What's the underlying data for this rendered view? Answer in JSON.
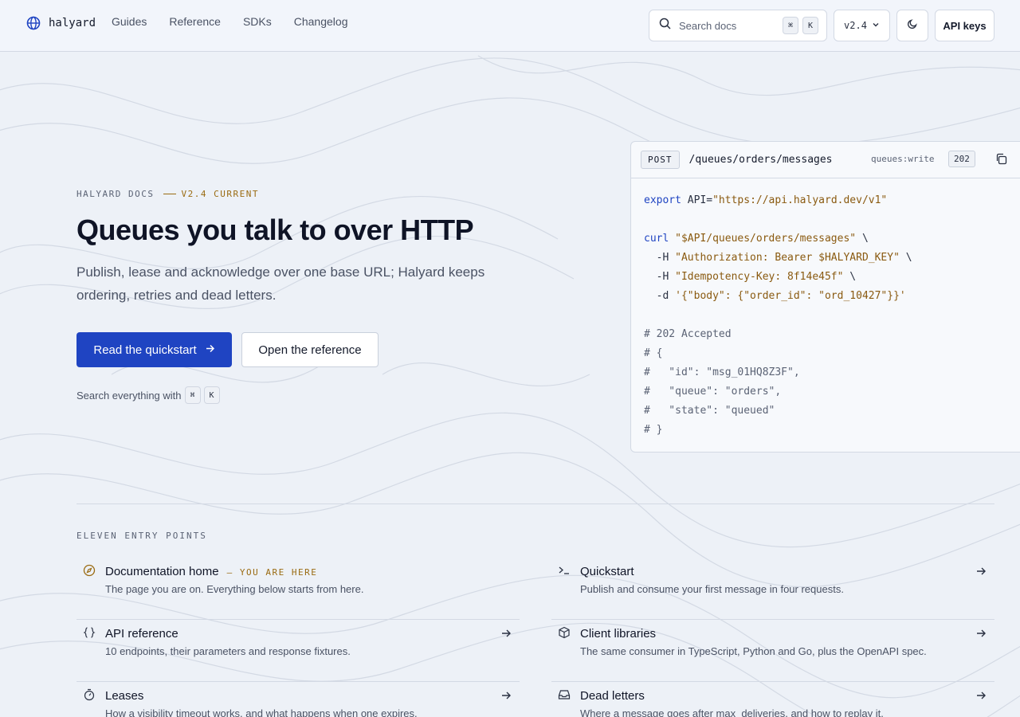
{
  "header": {
    "brand": "halyard",
    "nav": [
      "Guides",
      "Reference",
      "SDKs",
      "Changelog"
    ],
    "search": {
      "placeholder": "Search docs",
      "shortcut_keys": [
        "⌘",
        "K"
      ]
    },
    "version": "v2.4",
    "api_keys_label": "API keys"
  },
  "hero": {
    "eyebrow": "HALYARD DOCS",
    "eyebrow_accent": "V2.4 CURRENT",
    "title": "Queues you talk to over HTTP",
    "subtitle": "Publish, lease and acknowledge over one base URL; Halyard keeps ordering, retries and dead letters.",
    "primary_cta": "Read the quickstart",
    "secondary_cta": "Open the reference",
    "search_hint": "Search everything with",
    "hint_keys": [
      "⌘",
      "K"
    ]
  },
  "code_sample": {
    "method": "POST",
    "path": "/queues/orders/messages",
    "scope": "queues:write",
    "status": "202",
    "lines": {
      "l1_kw": "export",
      "l1_rest": " API=",
      "l1_str": "\"https://api.halyard.dev/v1\"",
      "l3_kw": "curl",
      "l3_str": "\"$API/queues/orders/messages\"",
      "l3_tail": " \\",
      "l4_flag": "  -H ",
      "l4_str": "\"Authorization: Bearer $HALYARD_KEY\"",
      "l4_tail": " \\",
      "l5_flag": "  -H ",
      "l5_str": "\"Idempotency-Key: 8f14e45f\"",
      "l5_tail": " \\",
      "l6_flag": "  -d ",
      "l6_str": "'{\"body\": {\"order_id\": \"ord_10427\"}}'",
      "l8": "# 202 Accepted",
      "l9": "# {",
      "l10": "#   \"id\": \"msg_01HQ8Z3F\",",
      "l11": "#   \"queue\": \"orders\",",
      "l12": "#   \"state\": \"queued\"",
      "l13": "# }"
    }
  },
  "entry_points": {
    "heading": "ELEVEN ENTRY POINTS",
    "items": [
      {
        "icon": "compass-icon",
        "title": "Documentation home",
        "badge": "YOU ARE HERE",
        "description": "The page you are on. Everything below starts from here."
      },
      {
        "icon": "terminal-icon",
        "title": "Quickstart",
        "description": "Publish and consume your first message in four requests."
      },
      {
        "icon": "braces-icon",
        "title": "API reference",
        "description": "10 endpoints, their parameters and response fixtures."
      },
      {
        "icon": "package-icon",
        "title": "Client libraries",
        "description": "The same consumer in TypeScript, Python and Go, plus the OpenAPI spec."
      },
      {
        "icon": "timer-icon",
        "title": "Leases",
        "description": "How a visibility timeout works, and what happens when one expires."
      },
      {
        "icon": "inbox-icon",
        "title": "Dead letters",
        "description": "Where a message goes after max_deliveries, and how to replay it."
      }
    ]
  },
  "colors": {
    "accent_blue": "#1f44c2",
    "accent_amber": "#9a6b12",
    "background": "#edf1f7"
  }
}
